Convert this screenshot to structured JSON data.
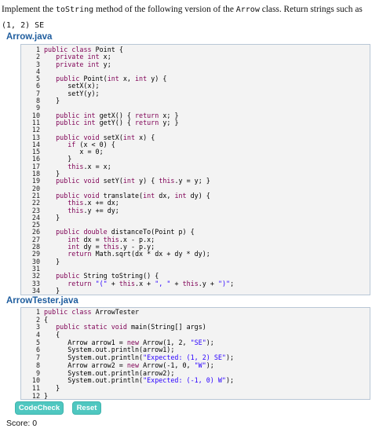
{
  "prompt": {
    "before": "Implement the ",
    "method": "toString",
    "middle": " method of the following version of the ",
    "class_name": "Arrow",
    "after": " class. Return strings such as",
    "sample": "(1, 2) SE"
  },
  "files": [
    {
      "title": "Arrow.java",
      "lines": [
        "public class Point {",
        "   private int x;",
        "   private int y;",
        "",
        "   public Point(int x, int y) {",
        "      setX(x);",
        "      setY(y);",
        "   }",
        "",
        "   public int getX() { return x; }",
        "   public int getY() { return y; }",
        "",
        "   public void setX(int x) {",
        "      if (x < 0) {",
        "         x = 0;",
        "      }",
        "      this.x = x;",
        "   }",
        "   public void setY(int y) { this.y = y; }",
        "",
        "   public void translate(int dx, int dy) {",
        "      this.x += dx;",
        "      this.y += dy;",
        "   }",
        "",
        "   public double distanceTo(Point p) {",
        "      int dx = this.x - p.x;",
        "      int dy = this.y - p.y;",
        "      return Math.sqrt(dx * dx + dy * dy);",
        "   }",
        "",
        "   public String toString() {",
        "      return \"(\" + this.x + \", \" + this.y + \")\";",
        "   }",
        "}"
      ]
    },
    {
      "title": "ArrowTester.java",
      "lines": [
        "public class ArrowTester",
        "{",
        "   public static void main(String[] args)",
        "   {",
        "      Arrow arrow1 = new Arrow(1, 2, \"SE\");",
        "      System.out.println(arrow1);",
        "      System.out.println(\"Expected: (1, 2) SE\");",
        "      Arrow arrow2 = new Arrow(-1, 0, \"W\");",
        "      System.out.println(arrow2);",
        "      System.out.println(\"Expected: (-1, 0) W\");",
        "   }",
        "}"
      ]
    }
  ],
  "buttons": {
    "codecheck": "CodeCheck",
    "reset": "Reset"
  },
  "score": "Score: 0",
  "colors": {
    "title": "#1f5d9e",
    "button": "#4fc7c0",
    "keyword": "#7f0055",
    "string": "#2a00ff"
  }
}
